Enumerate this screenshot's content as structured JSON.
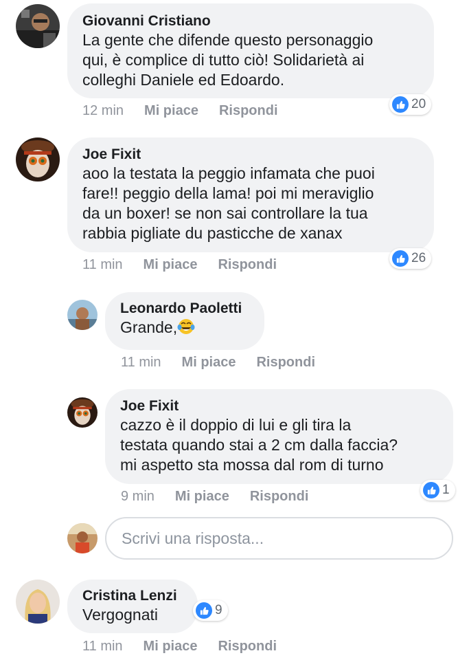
{
  "comments": [
    {
      "author": "Giovanni Cristiano",
      "text": "La gente che difende questo personaggio\nqui, è complice di tutto ciò! Solidarietà ai\ncolleghi Daniele ed Edoardo.",
      "time": "12 min",
      "like_label": "Mi piace",
      "reply_label": "Rispondi",
      "reactions": "20"
    },
    {
      "author": "Joe Fixit",
      "text": "aoo la testata la peggio infamata che puoi\nfare!! peggio della lama! poi mi meraviglio\nda un boxer! se non sai controllare la tua\nrabbia pigliate du pasticche de xanax",
      "time": "11 min",
      "like_label": "Mi piace",
      "reply_label": "Rispondi",
      "reactions": "26"
    },
    {
      "author": "Leonardo Paoletti",
      "text": "Grande,",
      "time": "11 min",
      "like_label": "Mi piace",
      "reply_label": "Rispondi"
    },
    {
      "author": "Joe Fixit",
      "text": "cazzo è il doppio di lui e gli tira la\ntestata quando stai a 2 cm dalla faccia?\nmi aspetto sta mossa dal rom di turno",
      "time": "9 min",
      "like_label": "Mi piace",
      "reply_label": "Rispondi",
      "reactions": "1"
    },
    {
      "author": "Cristina Lenzi",
      "text": "Vergognati",
      "time": "11 min",
      "like_label": "Mi piace",
      "reply_label": "Rispondi",
      "reactions": "9"
    }
  ],
  "reply_box": {
    "placeholder": "Scrivi una risposta..."
  },
  "colors": {
    "bubble": "#f1f2f4",
    "like_blue": "#2d88ff",
    "meta_gray": "#90949c"
  },
  "icons": {
    "reaction": "thumbs-up-icon",
    "emoji": "tears-of-joy-emoji"
  }
}
